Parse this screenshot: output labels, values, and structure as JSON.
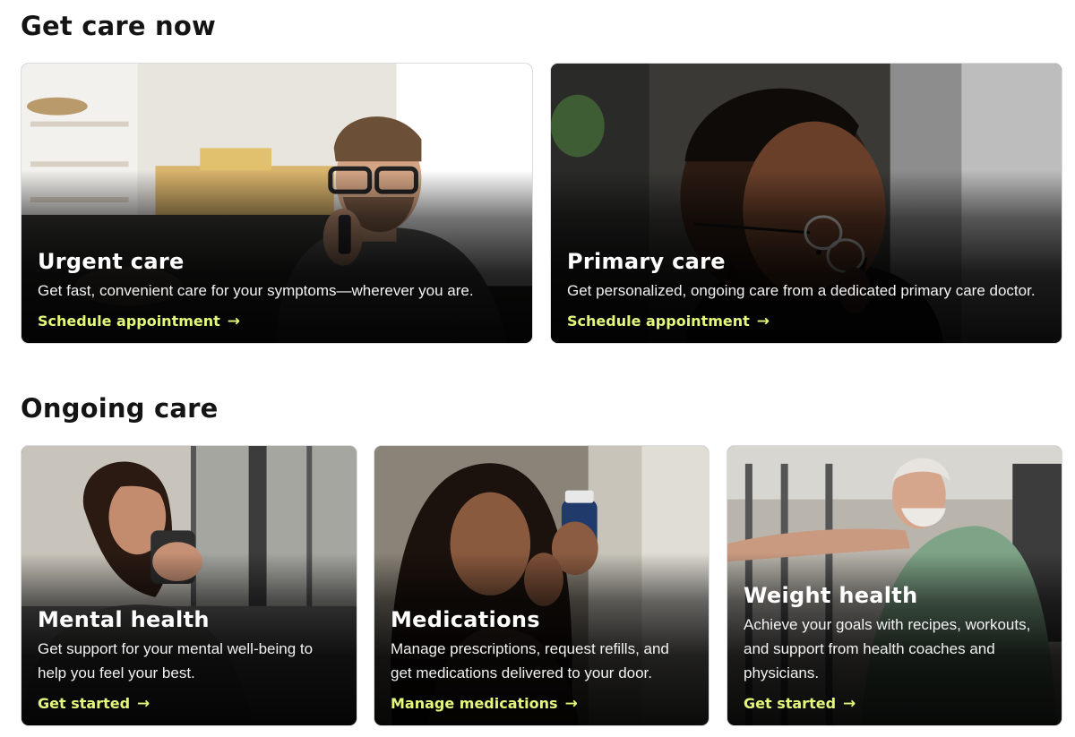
{
  "sections": [
    {
      "title": "Get care now",
      "cards": [
        {
          "title": "Urgent care",
          "description": "Get fast, convenient care for your symptoms—wherever you are.",
          "link": "Schedule appointment",
          "arrow": "→"
        },
        {
          "title": "Primary care",
          "description": "Get personalized, ongoing care from a dedicated primary care doctor.",
          "link": "Schedule appointment",
          "arrow": "→"
        }
      ]
    },
    {
      "title": "Ongoing care",
      "cards": [
        {
          "title": "Mental health",
          "description": "Get support for your mental well-being to help you feel your best.",
          "link": "Get started",
          "arrow": "→"
        },
        {
          "title": "Medications",
          "description": "Manage prescriptions, request refills, and get medications delivered to your door.",
          "link": "Manage medications",
          "arrow": "→"
        },
        {
          "title": "Weight health",
          "description": "Achieve your goals with recipes, workouts, and support from health coaches and physicians.",
          "link": "Get started",
          "arrow": "→"
        }
      ]
    }
  ],
  "colors": {
    "link_accent": "#e4f77a",
    "heading": "#141414",
    "card_text": "#ffffff"
  }
}
